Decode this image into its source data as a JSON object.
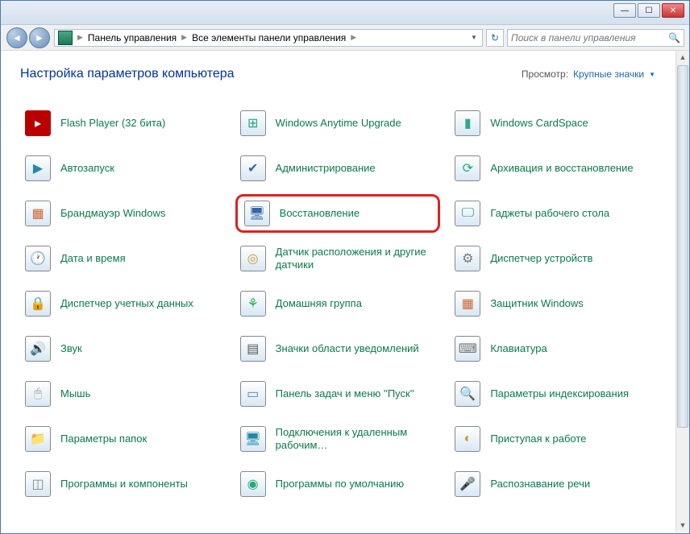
{
  "titlebar": {
    "minimize": "—",
    "maximize": "☐",
    "close": "✕"
  },
  "nav": {
    "back": "◄",
    "forward": "►",
    "breadcrumbs": [
      "Панель управления",
      "Все элементы панели управления"
    ],
    "sep": "▶",
    "refresh": "↻",
    "search_placeholder": "Поиск в панели управления",
    "search_icon": "🔍"
  },
  "header": {
    "title": "Настройка параметров компьютера",
    "view_label": "Просмотр:",
    "view_value": "Крупные значки"
  },
  "items": [
    {
      "label": "Flash Player (32 бита)",
      "icon": "flash-icon",
      "glyph": "▸",
      "bg": "#b00",
      "fg": "#fff"
    },
    {
      "label": "Windows Anytime Upgrade",
      "icon": "upgrade-icon",
      "glyph": "⊞",
      "bg": "#fff",
      "fg": "#2a7"
    },
    {
      "label": "Windows CardSpace",
      "icon": "cardspace-icon",
      "glyph": "▮",
      "bg": "#fff",
      "fg": "#3a8"
    },
    {
      "label": "Автозапуск",
      "icon": "autoplay-icon",
      "glyph": "▶",
      "bg": "#fff",
      "fg": "#28a"
    },
    {
      "label": "Администрирование",
      "icon": "admin-icon",
      "glyph": "✔",
      "bg": "#fff",
      "fg": "#36a"
    },
    {
      "label": "Архивация и восстановление",
      "icon": "backup-icon",
      "glyph": "⟳",
      "bg": "#fff",
      "fg": "#2a7"
    },
    {
      "label": "Брандмауэр Windows",
      "icon": "firewall-icon",
      "glyph": "▦",
      "bg": "#fff",
      "fg": "#c63"
    },
    {
      "label": "Восстановление",
      "icon": "recovery-icon",
      "glyph": "🖥",
      "bg": "#fff",
      "fg": "#36a",
      "highlight": true
    },
    {
      "label": "Гаджеты рабочего стола",
      "icon": "gadgets-icon",
      "glyph": "🖵",
      "bg": "#fff",
      "fg": "#28a"
    },
    {
      "label": "Дата и время",
      "icon": "datetime-icon",
      "glyph": "🕐",
      "bg": "#fff",
      "fg": "#48a"
    },
    {
      "label": "Датчик расположения и другие датчики",
      "icon": "sensor-icon",
      "glyph": "◎",
      "bg": "#fff",
      "fg": "#c93"
    },
    {
      "label": "Диспетчер устройств",
      "icon": "devmgr-icon",
      "glyph": "⚙",
      "bg": "#fff",
      "fg": "#777"
    },
    {
      "label": "Диспетчер учетных данных",
      "icon": "credentials-icon",
      "glyph": "🔒",
      "bg": "#fff",
      "fg": "#c93"
    },
    {
      "label": "Домашняя группа",
      "icon": "homegroup-icon",
      "glyph": "⚘",
      "bg": "#fff",
      "fg": "#2a5"
    },
    {
      "label": "Защитник Windows",
      "icon": "defender-icon",
      "glyph": "▦",
      "bg": "#fff",
      "fg": "#c63"
    },
    {
      "label": "Звук",
      "icon": "sound-icon",
      "glyph": "🔊",
      "bg": "#fff",
      "fg": "#777"
    },
    {
      "label": "Значки области уведомлений",
      "icon": "tray-icon",
      "glyph": "▤",
      "bg": "#fff",
      "fg": "#555"
    },
    {
      "label": "Клавиатура",
      "icon": "keyboard-icon",
      "glyph": "⌨",
      "bg": "#fff",
      "fg": "#777"
    },
    {
      "label": "Мышь",
      "icon": "mouse-icon",
      "glyph": "🖱",
      "bg": "#fff",
      "fg": "#999"
    },
    {
      "label": "Панель задач и меню ''Пуск''",
      "icon": "taskbar-icon",
      "glyph": "▭",
      "bg": "#fff",
      "fg": "#48a"
    },
    {
      "label": "Параметры индексирования",
      "icon": "indexing-icon",
      "glyph": "🔍",
      "bg": "#fff",
      "fg": "#48a"
    },
    {
      "label": "Параметры папок",
      "icon": "folders-icon",
      "glyph": "📁",
      "bg": "#fff",
      "fg": "#ca4"
    },
    {
      "label": "Подключения к удаленным рабочим…",
      "icon": "rdp-icon",
      "glyph": "🖥",
      "bg": "#fff",
      "fg": "#28a"
    },
    {
      "label": "Приступая к работе",
      "icon": "getstarted-icon",
      "glyph": "◐",
      "bg": "#fff",
      "fg": "#c93"
    },
    {
      "label": "Программы и компоненты",
      "icon": "programs-icon",
      "glyph": "◫",
      "bg": "#fff",
      "fg": "#888"
    },
    {
      "label": "Программы по умолчанию",
      "icon": "defaults-icon",
      "glyph": "◉",
      "bg": "#fff",
      "fg": "#2a7"
    },
    {
      "label": "Распознавание речи",
      "icon": "speech-icon",
      "glyph": "🎤",
      "bg": "#fff",
      "fg": "#555"
    }
  ]
}
